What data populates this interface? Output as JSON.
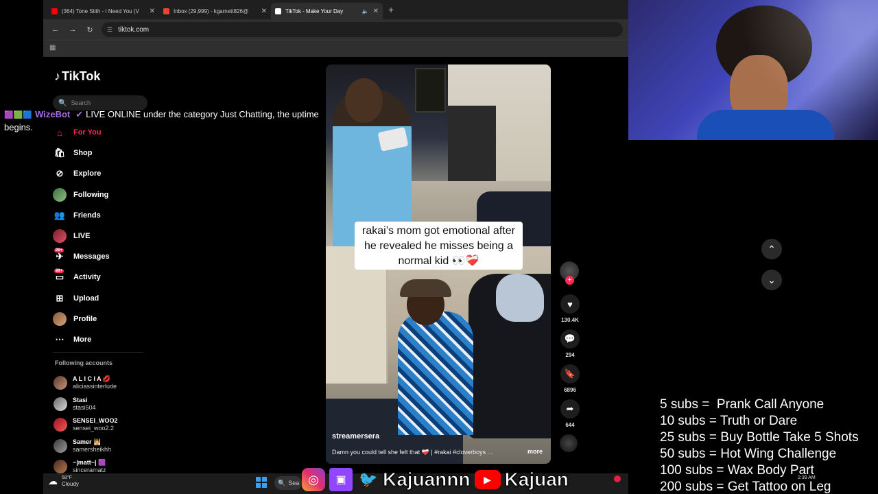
{
  "browser": {
    "tabs": [
      {
        "title": "(364) Tone Stith - I Need You (V",
        "favicon_color": "#ff0000",
        "active": false
      },
      {
        "title": "Inbox (29,999) - kgarnett826@",
        "favicon_color": "#ea4335",
        "active": false
      },
      {
        "title": "TikTok - Make Your Day",
        "favicon_color": "#ffffff",
        "active": true
      }
    ],
    "new_tab_glyph": "+",
    "address": "tiktok.com"
  },
  "tiktok": {
    "logo_text": "TikTok",
    "search_placeholder": "Search",
    "nav": [
      {
        "label": "For You",
        "icon": "home-icon",
        "active": true
      },
      {
        "label": "Shop",
        "icon": "shop-icon"
      },
      {
        "label": "Explore",
        "icon": "compass-icon"
      },
      {
        "label": "Following",
        "icon": "following-avatar-icon"
      },
      {
        "label": "Friends",
        "icon": "friends-icon"
      },
      {
        "label": "LIVE",
        "icon": "live-avatar-icon"
      },
      {
        "label": "Messages",
        "icon": "messages-icon",
        "badge": "99+"
      },
      {
        "label": "Activity",
        "icon": "activity-icon",
        "badge": "99+"
      },
      {
        "label": "Upload",
        "icon": "upload-icon"
      },
      {
        "label": "Profile",
        "icon": "profile-avatar-icon"
      },
      {
        "label": "More",
        "icon": "more-icon"
      }
    ],
    "following_heading": "Following accounts",
    "following": [
      {
        "name": "A L I C I A 💋",
        "handle": "aliciassinterlude"
      },
      {
        "name": "Stasi",
        "handle": "stasi504"
      },
      {
        "name": "SENSEI_WOO2",
        "handle": "sensei_woo2.2"
      },
      {
        "name": "Samer 🕌",
        "handle": "samersheikhh"
      },
      {
        "name": "~|matt~| 🟪",
        "handle": "sinceramatz"
      }
    ],
    "video": {
      "caption": "rakai’s mom got emotional after he revealed he misses being a normal kid 👀❤️‍🩹",
      "username": "streamersera",
      "description": "Damn you could tell she felt that ❤️‍🩹 | #rakai #cloverboys ...",
      "more_label": "more"
    },
    "actions": {
      "likes": "130.4K",
      "comments": "294",
      "saves": "6896",
      "shares": "644"
    }
  },
  "overlay": {
    "wizebot_icons": "🟪🟩🟦",
    "wizebot_name": "WizeBot",
    "wizebot_check": "✔",
    "wizebot_message": "LIVE ONLINE under the category Just Chatting, the uptime begins.",
    "sub_goals": [
      "5 subs =  Prank Call Anyone",
      "10 subs = Truth or Dare",
      "25 subs = Buy Bottle Take 5 Shots",
      "50 subs = Hot Wing Challenge",
      "100 subs = Wax Body Part",
      "200 subs = Get Tattoo on Leg"
    ],
    "social_name_1": "Kajuannn",
    "social_name_2": "Kajuan"
  },
  "taskbar": {
    "weather_temp": "58°F",
    "weather_desc": "Cloudy",
    "search_label": "Sea",
    "time": "2:39 AM"
  },
  "colors": {
    "accent": "#fe2c55",
    "twitch_purple": "#9146ff"
  }
}
